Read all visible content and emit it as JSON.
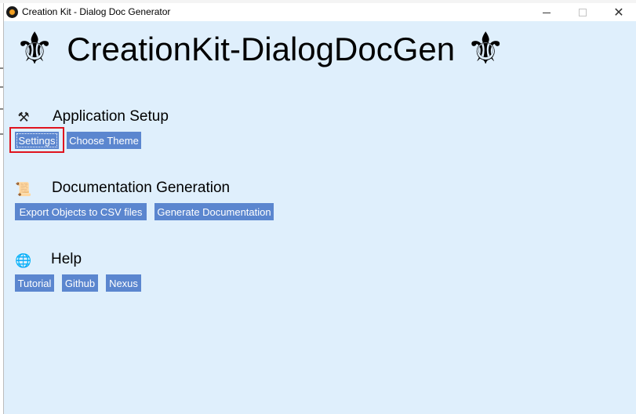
{
  "window": {
    "title": "Creation Kit - Dialog Doc Generator",
    "close_glyph": "✕"
  },
  "banner": {
    "ornament_left": "⚜",
    "title": "CreationKit-DialogDocGen",
    "ornament_right": "⚜"
  },
  "sections": {
    "setup": {
      "icon": "hammer-and-wrench-icon",
      "icon_glyph": "⚒",
      "title": "Application Setup",
      "buttons": {
        "settings": "Settings",
        "choose_theme": "Choose Theme"
      }
    },
    "docs": {
      "icon": "scroll-icon",
      "icon_glyph": "📜",
      "title": "Documentation Generation",
      "buttons": {
        "export_csv": "Export Objects to CSV files",
        "generate_docs": "Generate Documentation"
      }
    },
    "help": {
      "icon": "globe-icon",
      "icon_glyph": "🌐",
      "title": "Help",
      "buttons": {
        "tutorial": "Tutorial",
        "github": "Github",
        "nexus": "Nexus"
      }
    }
  },
  "colors": {
    "content_background": "#dfeffc",
    "button_background": "#5b86cf",
    "button_text": "#ffffff",
    "highlight_border": "#e0141e"
  }
}
